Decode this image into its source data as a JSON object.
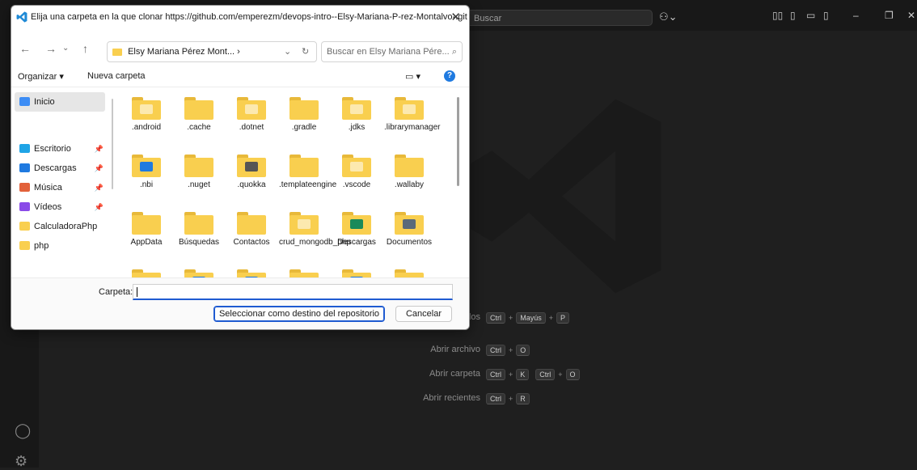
{
  "vscode": {
    "search_placeholder": "Buscar",
    "shortcuts": [
      {
        "label": "los dos",
        "keys": [
          [
            "Ctrl",
            "Mayús",
            "P"
          ]
        ]
      },
      {
        "label": "Abrir archivo",
        "keys": [
          [
            "Ctrl",
            "O"
          ]
        ]
      },
      {
        "label": "Abrir carpeta",
        "keys": [
          [
            "Ctrl",
            "K"
          ],
          [
            "Ctrl",
            "O"
          ]
        ]
      },
      {
        "label": "Abrir recientes",
        "keys": [
          [
            "Ctrl",
            "R"
          ]
        ]
      }
    ]
  },
  "dialog": {
    "title": "Elija una carpeta en la que clonar https://github.com/emperezm/devops-intro--Elsy-Mariana-P-rez-Montalvo-.git",
    "address": "Elsy Mariana Pérez Mont... ›",
    "address_sep": "›",
    "search_placeholder": "Buscar en Elsy Mariana Pére...",
    "toolbar": {
      "organize": "Organizar ▾",
      "new_folder": "Nueva carpeta"
    },
    "nav": [
      {
        "label": "Inicio",
        "selected": true,
        "pinned": false,
        "icon": "home-icon",
        "color": "#3d8df5"
      },
      {
        "label": "Escritorio",
        "selected": false,
        "pinned": true,
        "icon": "desktop-icon",
        "color": "#1fa4e6"
      },
      {
        "label": "Descargas",
        "selected": false,
        "pinned": true,
        "icon": "download-icon",
        "color": "#1f7ae0"
      },
      {
        "label": "Música",
        "selected": false,
        "pinned": true,
        "icon": "music-icon",
        "color": "#e2613a"
      },
      {
        "label": "Vídeos",
        "selected": false,
        "pinned": true,
        "icon": "video-icon",
        "color": "#8a4ae8"
      },
      {
        "label": "CalculadoraPhp",
        "selected": false,
        "pinned": false,
        "icon": "folder-icon",
        "color": "#f9cf4f"
      },
      {
        "label": "php",
        "selected": false,
        "pinned": false,
        "icon": "folder-icon",
        "color": "#f9cf4f"
      }
    ],
    "folders": [
      {
        "name": ".android",
        "overlay": "#ffffff"
      },
      {
        "name": ".cache",
        "overlay": ""
      },
      {
        "name": ".dotnet",
        "overlay": "#ffffff"
      },
      {
        "name": ".gradle",
        "overlay": ""
      },
      {
        "name": ".jdks",
        "overlay": "#ffffff"
      },
      {
        "name": ".librarymanager",
        "overlay": "#ffffff"
      },
      {
        "name": ".nbi",
        "overlay": "#1f7ae0"
      },
      {
        "name": ".nuget",
        "overlay": ""
      },
      {
        "name": ".quokka",
        "overlay": "#555555"
      },
      {
        "name": ".templateengine",
        "overlay": ""
      },
      {
        "name": ".vscode",
        "overlay": "#ffffff"
      },
      {
        "name": ".wallaby",
        "overlay": ""
      },
      {
        "name": "AppData",
        "overlay": ""
      },
      {
        "name": "Búsquedas",
        "overlay": ""
      },
      {
        "name": "Contactos",
        "overlay": ""
      },
      {
        "name": "crud_mongodb_php",
        "overlay": "#ffffff"
      },
      {
        "name": "Descargas",
        "overlay": "#1a8a5a"
      },
      {
        "name": "Documentos",
        "overlay": "#5a6a7a"
      },
      {
        "name": "",
        "overlay": ""
      },
      {
        "name": "",
        "overlay": "#1f7ae0"
      },
      {
        "name": "",
        "overlay": "#1f7ae0"
      },
      {
        "name": "",
        "overlay": ""
      },
      {
        "name": "",
        "overlay": "#1f7ae0"
      },
      {
        "name": "",
        "overlay": ""
      }
    ],
    "folder_label": "Carpeta:",
    "folder_value": "",
    "select_button": "Seleccionar como destino del repositorio",
    "cancel_button": "Cancelar"
  }
}
